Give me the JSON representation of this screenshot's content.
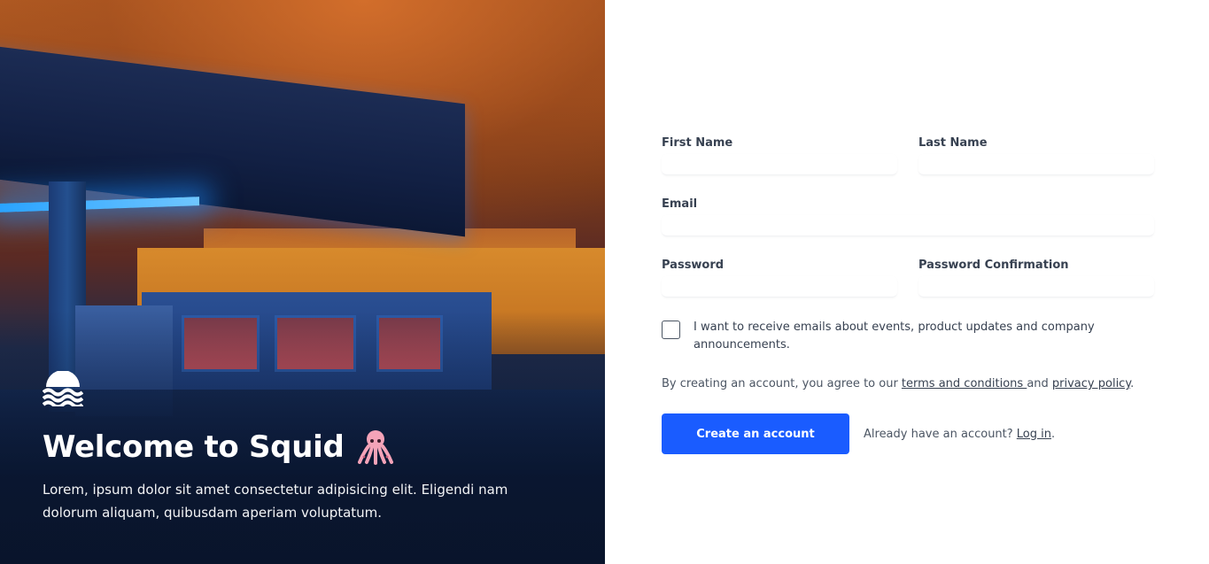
{
  "hero": {
    "title": "Welcome to Squid",
    "emoji": "squid",
    "description": "Lorem, ipsum dolor sit amet consectetur adipisicing elit. Eligendi nam dolorum aliquam, quibusdam aperiam voluptatum.",
    "logo_icon": "waves-logo-icon"
  },
  "form": {
    "first_name_label": "First Name",
    "first_name_value": "",
    "last_name_label": "Last Name",
    "last_name_value": "",
    "email_label": "Email",
    "email_value": "",
    "password_label": "Password",
    "password_value": "",
    "password_confirmation_label": "Password Confirmation",
    "password_confirmation_value": "",
    "marketing_consent_label": "I want to receive emails about events, product updates and company announcements.",
    "marketing_consent_checked": false,
    "terms_prefix": "By creating an account, you agree to our ",
    "terms_link": "terms and conditions ",
    "terms_middle": "and ",
    "privacy_link": "privacy policy",
    "terms_suffix": ".",
    "submit_label": "Create an account",
    "login_prefix": "Already have an account? ",
    "login_link": "Log in",
    "login_suffix": "."
  },
  "colors": {
    "accent": "#1a5cff",
    "hero_text": "#ffffff"
  }
}
